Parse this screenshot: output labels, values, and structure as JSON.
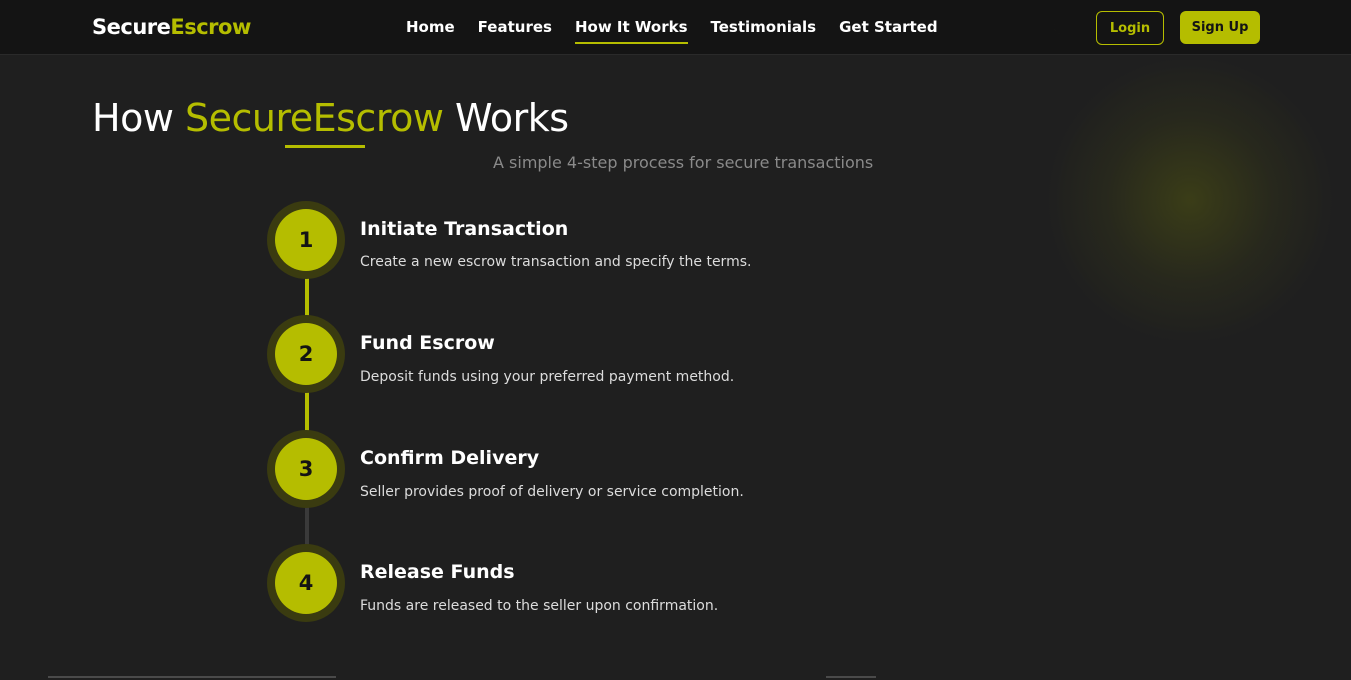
{
  "brand": {
    "part1": "Secure",
    "part2": "Escrow"
  },
  "nav": {
    "links": [
      "Home",
      "Features",
      "How It Works",
      "Testimonials",
      "Get Started"
    ],
    "active": "How It Works",
    "theme_icon": "moon-icon",
    "login_label": "Login",
    "signup_label": "Sign Up"
  },
  "hero": {
    "title_pre": "How ",
    "title_accent": "SecureEscrow",
    "title_post": " Works",
    "subtitle": "A simple 4-step process for secure transactions"
  },
  "steps": [
    {
      "number": "1",
      "title": "Initiate Transaction",
      "description": "Create a new escrow transaction and specify the terms."
    },
    {
      "number": "2",
      "title": "Fund Escrow",
      "description": "Deposit funds using your preferred payment method."
    },
    {
      "number": "3",
      "title": "Confirm Delivery",
      "description": "Seller provides proof of delivery or service completion."
    },
    {
      "number": "4",
      "title": "Release Funds",
      "description": "Funds are released to the seller upon confirmation."
    }
  ],
  "colors": {
    "accent": "#b5bd00",
    "background": "#1f1f1f",
    "navbar": "#141414",
    "muted_text": "#8a8a8a"
  }
}
